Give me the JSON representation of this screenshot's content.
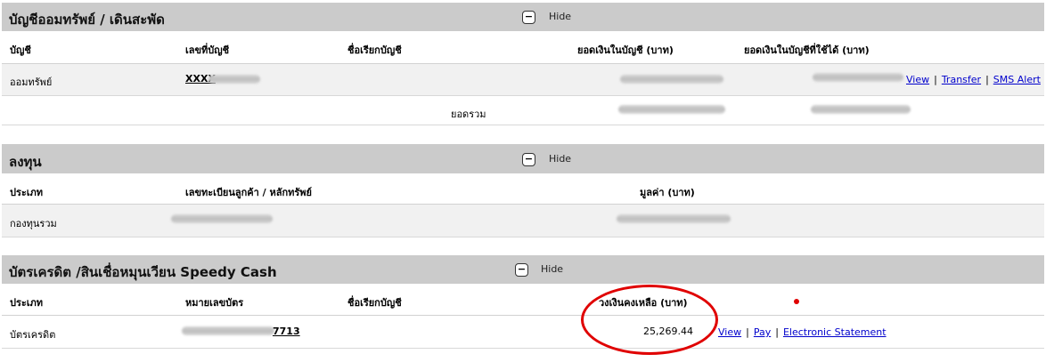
{
  "savings": {
    "title": "บัญชีออมทรัพย์ / เดินสะพัด",
    "hide": "Hide",
    "toggle": "−",
    "headers": {
      "account": "บัญชี",
      "number": "เลขที่บัญชี",
      "nickname": "ชื่อเรียกบัญชี",
      "balance": "ยอดเงินในบัญชี (บาท)",
      "available": "ยอดเงินในบัญชีที่ใช้ได้ (บาท)"
    },
    "row": {
      "type": "ออมทรัพย์",
      "number": "XXXX",
      "links": {
        "view": "View",
        "transfer": "Transfer",
        "sms": "SMS Alert"
      }
    },
    "total_label": "ยอดรวม"
  },
  "invest": {
    "title": "ลงทุน",
    "hide": "Hide",
    "toggle": "−",
    "headers": {
      "type": "ประเภท",
      "registry": "เลขทะเบียนลูกค้า / หลักทรัพย์",
      "value": "มูลค่า (บาท)"
    },
    "row": {
      "type": "กองทุนรวม"
    }
  },
  "credit": {
    "title": "บัตรเครดิต /สินเชื่อหมุนเวียน Speedy Cash",
    "hide": "Hide",
    "toggle": "−",
    "headers": {
      "type": "ประเภท",
      "card_no": "หมายเลขบัตร",
      "nickname": "ชื่อเรียกบัญชี",
      "remaining": "วงเงินคงเหลือ (บาท)"
    },
    "row": {
      "type": "บัตรเครดิต",
      "card_suffix": "7713",
      "remaining": "25,269.44",
      "links": {
        "view": "View",
        "pay": "Pay",
        "statement": "Electronic Statement"
      }
    }
  },
  "colors": {
    "header_bg": "#cbcbcb",
    "row_bg": "#f1f1f1",
    "link": "#0000cc",
    "annotation": "#e00000"
  }
}
